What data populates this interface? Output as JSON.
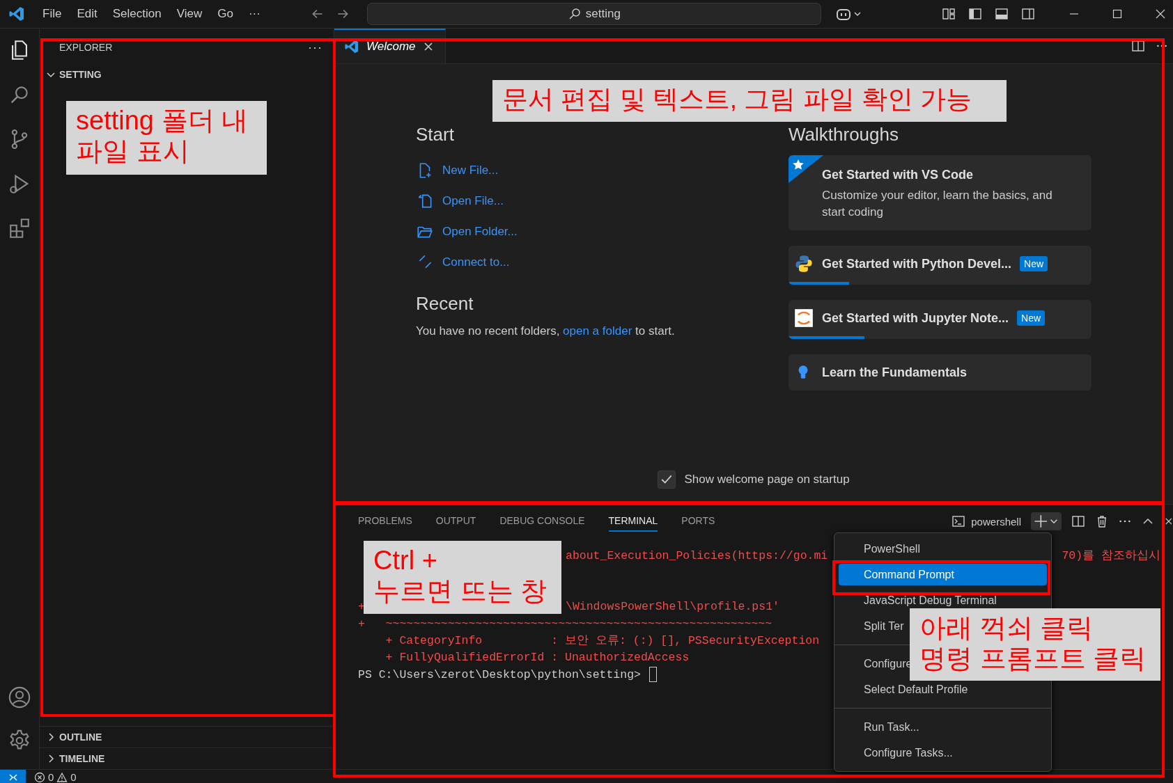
{
  "title_bar": {
    "menus": [
      "File",
      "Edit",
      "Selection",
      "View",
      "Go",
      "···"
    ],
    "search": "setting"
  },
  "activity_bar": [
    {
      "kind": "files",
      "selected": true
    },
    {
      "kind": "search",
      "selected": false
    },
    {
      "kind": "source-control",
      "selected": false
    },
    {
      "kind": "run",
      "selected": false
    },
    {
      "kind": "extensions",
      "selected": false
    }
  ],
  "sidebar": {
    "title": "EXPLORER",
    "more": "···",
    "folder": {
      "label": "SETTING",
      "expanded": true
    },
    "sections": [
      {
        "label": "OUTLINE",
        "expanded": false
      },
      {
        "label": "TIMELINE",
        "expanded": false
      }
    ]
  },
  "editor": {
    "tabs": [
      {
        "label": "Welcome",
        "selected": true
      }
    ],
    "welcome": {
      "start_heading": "Start",
      "start_items": [
        {
          "kind": "new-file",
          "label": "New File..."
        },
        {
          "kind": "open-file",
          "label": "Open File..."
        },
        {
          "kind": "open-folder",
          "label": "Open Folder..."
        },
        {
          "kind": "connect",
          "label": "Connect to..."
        }
      ],
      "recent_heading": "Recent",
      "recent_before": "You have no recent folders, ",
      "recent_link": "open a folder",
      "recent_after": " to start.",
      "walkthroughs_heading": "Walkthroughs",
      "walkthroughs": [
        {
          "kind": "featured",
          "title": "Get Started with VS Code",
          "description": "Customize your editor, learn the basics, and start coding"
        },
        {
          "kind": "python",
          "title": "Get Started with Python Devel...",
          "badge": "New",
          "level": 0.2
        },
        {
          "kind": "jupyter",
          "title": "Get Started with Jupyter Note...",
          "badge": "New",
          "level": 0.25
        },
        {
          "kind": "bulb",
          "title": "Learn the Fundamentals"
        }
      ],
      "show_on_startup": {
        "label": "Show welcome page on startup",
        "checked": true
      }
    }
  },
  "panel": {
    "tabs": [
      {
        "label": "PROBLEMS",
        "selected": false
      },
      {
        "label": "OUTPUT",
        "selected": false
      },
      {
        "label": "DEBUG CONSOLE",
        "selected": false
      },
      {
        "label": "TERMINAL",
        "selected": true
      },
      {
        "label": "PORTS",
        "selected": false
      }
    ],
    "terminal_name": "powershell",
    "lines": [
      {
        "kind": "error",
        "covered": true,
        "text": "about_Execution_Policies(https://go.mi",
        "tail": "70)를 참조하십시"
      },
      {
        "kind": "covered"
      },
      {
        "kind": "covered"
      },
      {
        "kind": "error",
        "covered": true,
        "lead": "+",
        "text": "\\WindowsPowerShell\\profile.ps1'"
      },
      {
        "kind": "error",
        "text": "+   ~~~~~~~~~~~~~~~~~~~~~~~~~~~~~~~~~~~~~~~~~~~~~~~~~~~~~~~~"
      },
      {
        "kind": "error",
        "text": "    + CategoryInfo          : 보안 오류: (:) [], PSSecurityException"
      },
      {
        "kind": "error",
        "text": "    + FullyQualifiedErrorId : UnauthorizedAccess"
      },
      {
        "kind": "prompt",
        "text": "PS C:\\Users\\zerot\\Desktop\\python\\setting> "
      }
    ],
    "menu": [
      {
        "items": [
          {
            "label": "PowerShell",
            "selected": false
          },
          {
            "label": "Command Prompt",
            "selected": true
          },
          {
            "label": "JavaScript Debug Terminal",
            "selected": false
          },
          {
            "label": "Split Ter",
            "selected": false
          }
        ]
      },
      {
        "items": [
          {
            "label": "Configure",
            "selected": false
          },
          {
            "label": "Select Default Profile",
            "selected": false
          }
        ]
      },
      {
        "items": [
          {
            "label": "Run Task...",
            "selected": false
          },
          {
            "label": "Configure Tasks...",
            "selected": false
          }
        ]
      }
    ]
  },
  "status_bar": {
    "errors": "0",
    "warnings": "0"
  },
  "annotations": [
    {
      "kind": "sidebar",
      "text": "setting 폴더 내\n파일 표시"
    },
    {
      "kind": "editor",
      "text": "문서 편집 및 텍스트, 그림 파일 확인 가능"
    },
    {
      "kind": "terminal",
      "text": "Ctrl +\n누르면 뜨는 창"
    },
    {
      "kind": "menu",
      "text": "아래 꺽쇠 클릭\n명령 프롬프트 클릭"
    }
  ]
}
